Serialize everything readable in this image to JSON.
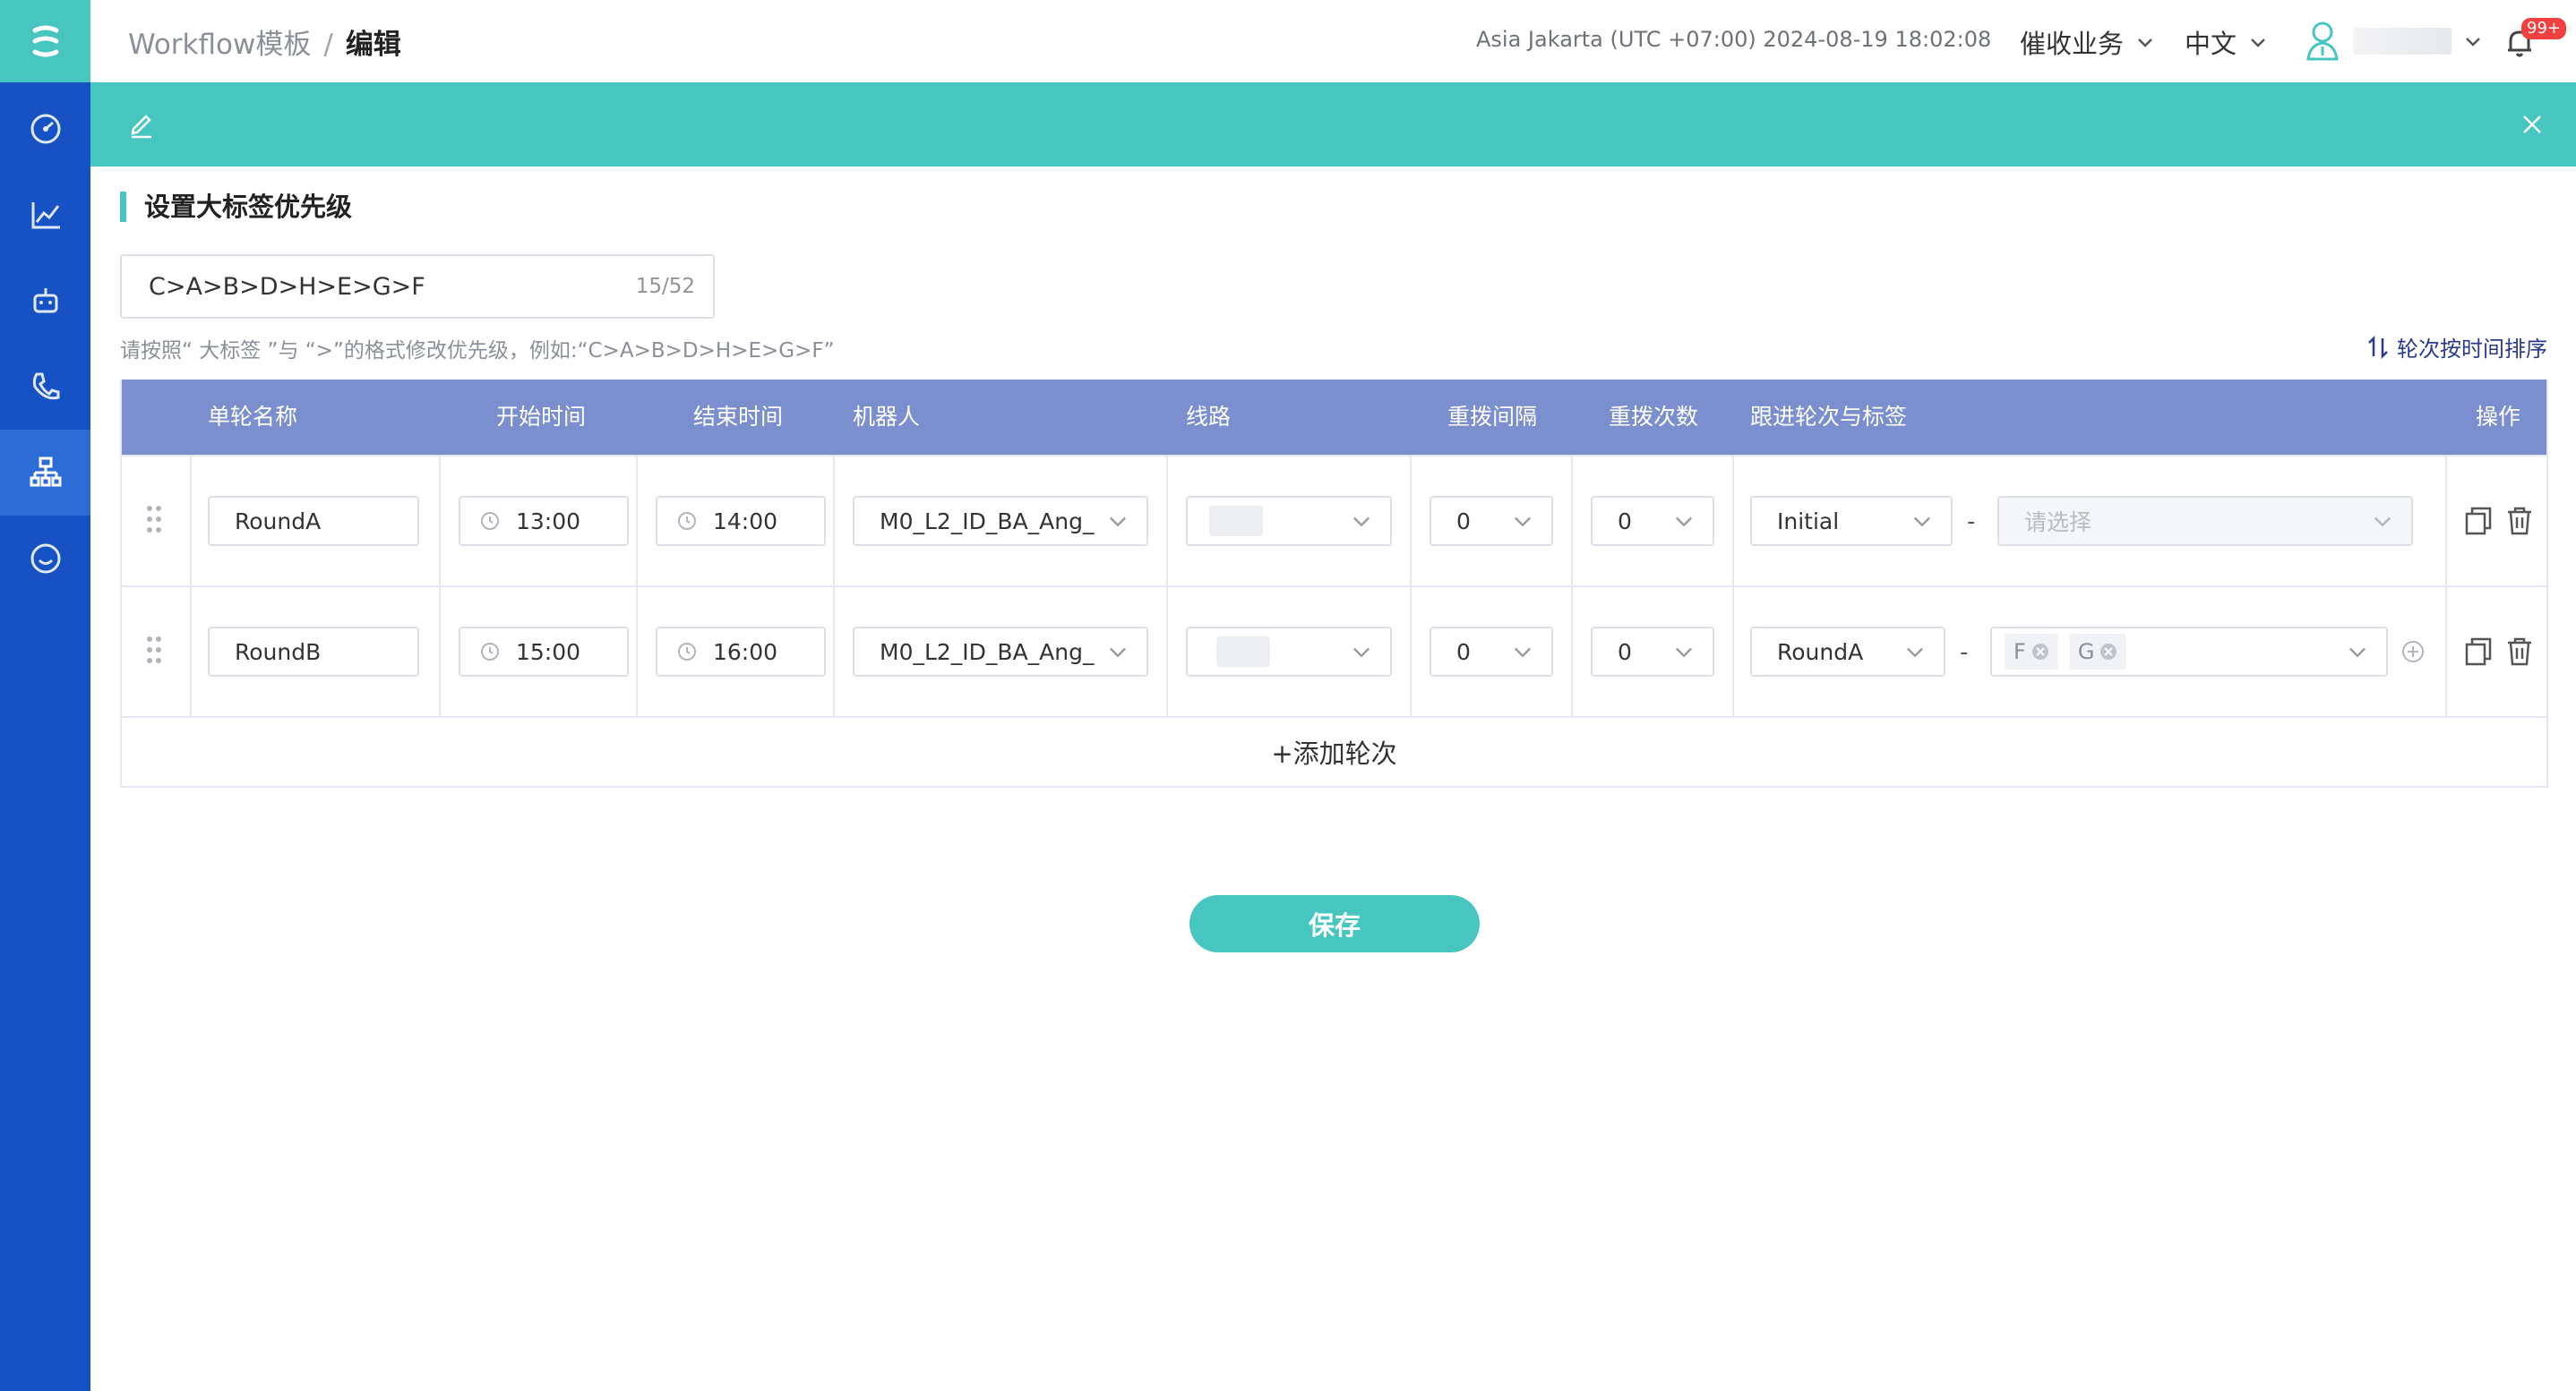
{
  "breadcrumb": {
    "parent": "Workflow模板",
    "separator": "/",
    "current": "编辑"
  },
  "header": {
    "timezone": "Asia Jakarta (UTC +07:00) 2024-08-19 18:02:08",
    "business_menu": "催收业务",
    "language_menu": "中文",
    "notification_badge": "99+"
  },
  "section": {
    "title": "设置大标签优先级",
    "priority_value": "C>A>B>D>H>E>G>F",
    "priority_counter": "15/52",
    "hint": "请按照“ 大标签 ”与 “>”的格式修改优先级，例如:“C>A>B>D>H>E>G>F”",
    "sort_link": "轮次按时间排序"
  },
  "table": {
    "headers": [
      "单轮名称",
      "开始时间",
      "结束时间",
      "机器人",
      "线路",
      "重拨间隔",
      "重拨次数",
      "跟进轮次与标签",
      "操作"
    ],
    "rows": [
      {
        "name": "RoundA",
        "start": "13:00",
        "end": "14:00",
        "robot": "M0_L2_ID_BA_Ang_",
        "interval": "0",
        "count": "0",
        "follow_round": "Initial",
        "tag_placeholder": "请选择",
        "tags": []
      },
      {
        "name": "RoundB",
        "start": "15:00",
        "end": "16:00",
        "robot": "M0_L2_ID_BA_Ang_",
        "interval": "0",
        "count": "0",
        "follow_round": "RoundA",
        "tag_placeholder": "",
        "tags": [
          "F",
          "G"
        ]
      }
    ],
    "add_row_label": "+添加轮次"
  },
  "save_label": "保存",
  "colors": {
    "sidebar": "#1652c4",
    "accent": "#47c6bf",
    "table_header": "#7b8fcf"
  }
}
